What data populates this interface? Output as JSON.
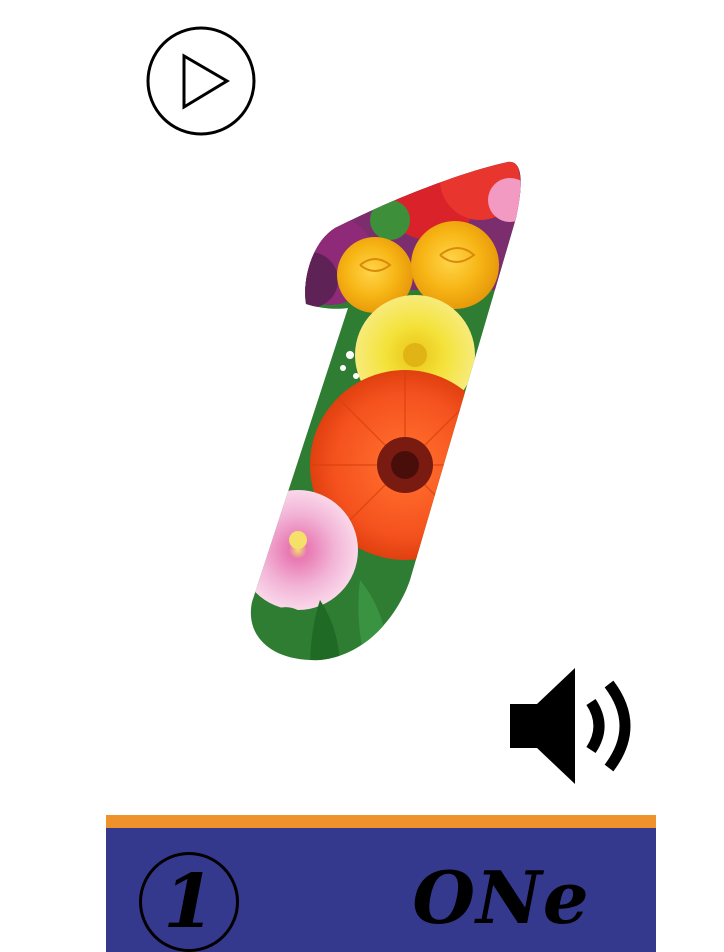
{
  "controls": {
    "play_icon": "play-icon",
    "speaker_icon": "speaker-icon"
  },
  "illustration": {
    "numeral": "1",
    "fill": "flowers"
  },
  "word_bar": {
    "digit": "1",
    "word": "ONe",
    "accent_color": "#F0922B",
    "panel_color": "#34398E"
  },
  "flower_colors": {
    "orange_gerbera": "#F4511E",
    "gerbera_center": "#7A1B12",
    "yellow_rose": "#F7B515",
    "yellow_mum": "#F4E23A",
    "pink_mum": "#F2B3D6",
    "magenta": "#8E2A78",
    "red": "#D9222A",
    "leaf": "#2F7D32"
  }
}
